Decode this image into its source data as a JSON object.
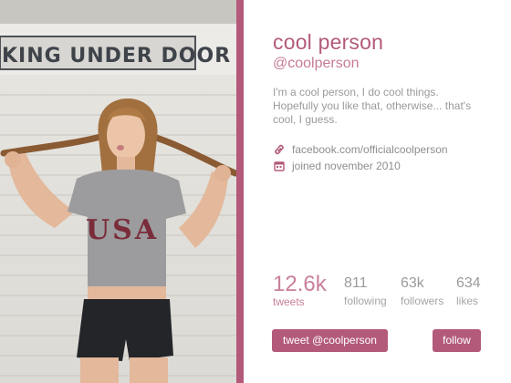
{
  "sign": {
    "text": "KING UNDER DOOR"
  },
  "profile": {
    "name": "cool person",
    "handle": "@coolperson",
    "bio": "I'm a cool person, I do cool things. Hopefully you like that, otherwise... that's cool, I guess.",
    "link": "facebook.com/officialcoolperson",
    "joined": "joined november 2010",
    "link_icon": "link-icon",
    "calendar_icon": "calendar-icon"
  },
  "shirt": {
    "text": "USA"
  },
  "stats": [
    {
      "value": "12.6k",
      "label": "tweets"
    },
    {
      "value": "811",
      "label": "following"
    },
    {
      "value": "63k",
      "label": "followers"
    },
    {
      "value": "634",
      "label": "likes"
    }
  ],
  "buttons": {
    "tweet": "tweet @coolperson",
    "follow": "follow"
  },
  "colors": {
    "accent": "#b35a7b",
    "accent_light": "#c97f9c",
    "muted_text": "#9a9a9a"
  }
}
